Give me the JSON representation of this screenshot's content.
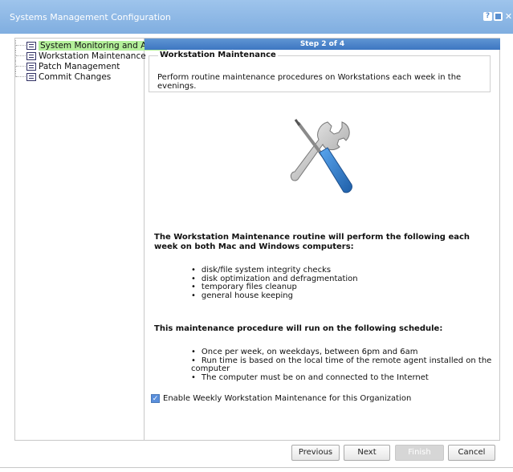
{
  "window": {
    "title": "Systems Management Configuration",
    "help_glyph": "?"
  },
  "tree": {
    "items": [
      {
        "label": "System Monitoring and Alerts",
        "selected": true
      },
      {
        "label": "Workstation Maintenance",
        "selected": false
      },
      {
        "label": "Patch Management",
        "selected": false
      },
      {
        "label": "Commit Changes",
        "selected": false
      }
    ]
  },
  "step": {
    "text": "Step 2 of 4"
  },
  "section": {
    "legend": "Workstation Maintenance",
    "description": "Perform routine maintenance procedures on Workstations each week in the evenings."
  },
  "body": {
    "intro": "The Workstation Maintenance routine will perform the following each week on both Mac and Windows computers:",
    "tasks": [
      "disk/file system integrity checks",
      "disk optimization and defragmentation",
      "temporary files cleanup",
      "general house keeping"
    ],
    "schedule_intro": "This maintenance procedure will run on the following schedule:",
    "schedule": [
      "Once per week, on weekdays, between 6pm and 6am",
      "Run time is based on the local time of the remote agent installed on the computer",
      "The computer must be on and connected to the Internet"
    ]
  },
  "checkbox": {
    "label": "Enable Weekly Workstation Maintenance for this Organization",
    "checked": true,
    "glyph": "✓"
  },
  "buttons": {
    "previous": "Previous",
    "next": "Next",
    "finish": "Finish",
    "cancel": "Cancel"
  },
  "colors": {
    "titlebar": "#8fb9e6",
    "stepbar": "#4b83c9",
    "selected_item": "#b4f09a",
    "tool_blue": "#2f7ccc"
  },
  "icons": {
    "main": "wrench-screwdriver-icon",
    "tree_item": "list-document-icon",
    "restore": "restore-icon",
    "close": "close-icon"
  }
}
